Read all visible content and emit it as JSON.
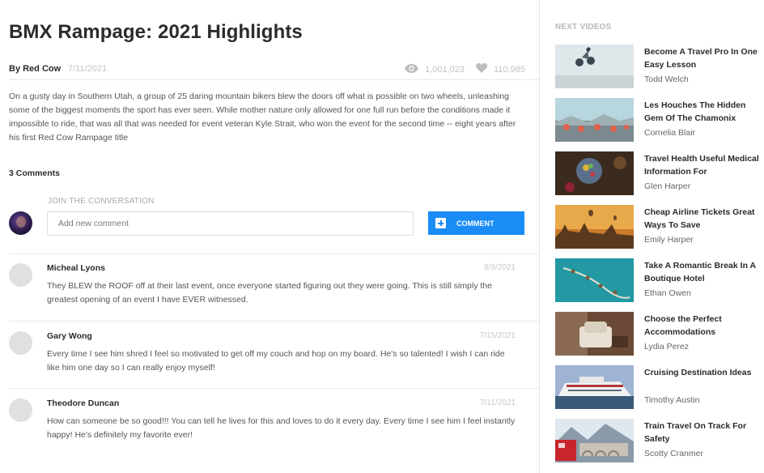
{
  "article": {
    "title": "BMX Rampage: 2021 Highlights",
    "author": "By Red Cow",
    "date": "7/11/2021",
    "views": "1,001,023",
    "likes": "110,985",
    "description": "On a gusty day in Southern Utah, a group of 25 daring mountain bikers blew the doors off what is possible on two wheels, unleashing some of the biggest moments the sport has ever seen. While mother nature only allowed for one full run before the conditions made it impossible to ride, that was all that was needed for event veteran Kyle Strait, who won the event for the second time -- eight years after his first Red Cow Rampage title"
  },
  "comments_section": {
    "count_label": "3 Comments",
    "join_label": "JOIN THE CONVERSATION",
    "input_placeholder": "Add new comment",
    "button_label": "COMMENT",
    "comments": [
      {
        "name": "Micheal Lyons",
        "date": "8/9/2021",
        "text": "They BLEW the ROOF off at their last event, once everyone started figuring out they were going. This is still simply the greatest opening of an event I have EVER witnessed."
      },
      {
        "name": "Gary Wong",
        "date": "7/15/2021",
        "text": "Every time I see him shred I feel so motivated to get off my couch and hop on my board. He's so talented! I wish I can ride like him one day so I can really enjoy myself!"
      },
      {
        "name": "Theodore Duncan",
        "date": "7/11/2021",
        "text": "How can someone be so good!!! You can tell he lives for this and loves to do it every day. Every time I see him I feel instantly happy! He's definitely my favorite ever!"
      }
    ]
  },
  "sidebar": {
    "heading": "NEXT VIDEOS",
    "videos": [
      {
        "title": "Become A Travel Pro In One Easy Lesson",
        "author": "Todd Welch"
      },
      {
        "title": "Les Houches The Hidden Gem Of The Chamonix",
        "author": "Cornelia Blair"
      },
      {
        "title": "Travel Health Useful Medical Information For",
        "author": "Glen Harper"
      },
      {
        "title": "Cheap Airline Tickets Great Ways To Save",
        "author": "Emily Harper"
      },
      {
        "title": "Take A Romantic Break In A Boutique Hotel",
        "author": "Ethan Owen"
      },
      {
        "title": "Choose the Perfect Accommodations",
        "author": "Lydia Perez"
      },
      {
        "title": "Cruising Destination Ideas",
        "author": "Timothy Austin"
      },
      {
        "title": "Train Travel On Track For Safety",
        "author": "Scotty Cranmer"
      }
    ]
  },
  "colors": {
    "accent": "#1a8cf6",
    "text_dark": "#2b2b2b",
    "muted": "#c4c4c4"
  }
}
